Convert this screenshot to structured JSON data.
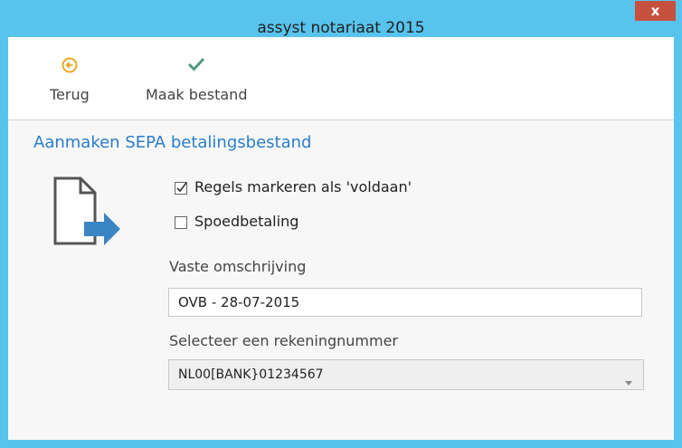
{
  "window": {
    "title": "assyst notariaat 2015",
    "close_label": "x"
  },
  "toolbar": {
    "back_label": "Terug",
    "make_file_label": "Maak bestand"
  },
  "form": {
    "heading": "Aanmaken SEPA betalingsbestand",
    "mark_paid": {
      "label": "Regels markeren als 'voldaan'",
      "checked": true
    },
    "urgent": {
      "label": "Spoedbetaling",
      "checked": false
    },
    "description_label": "Vaste omschrijving",
    "description_value": "OVB - 28-07-2015",
    "account_label": "Selecteer een rekeningnummer",
    "account_value": "NL00[BANK}01234567"
  },
  "colors": {
    "titlebar": "#58c3ec",
    "close": "#c7513f",
    "heading": "#2a7ec8",
    "back_icon": "#e8a317",
    "check_icon": "#4f9a7d",
    "doc_arrow": "#3a85c4"
  }
}
